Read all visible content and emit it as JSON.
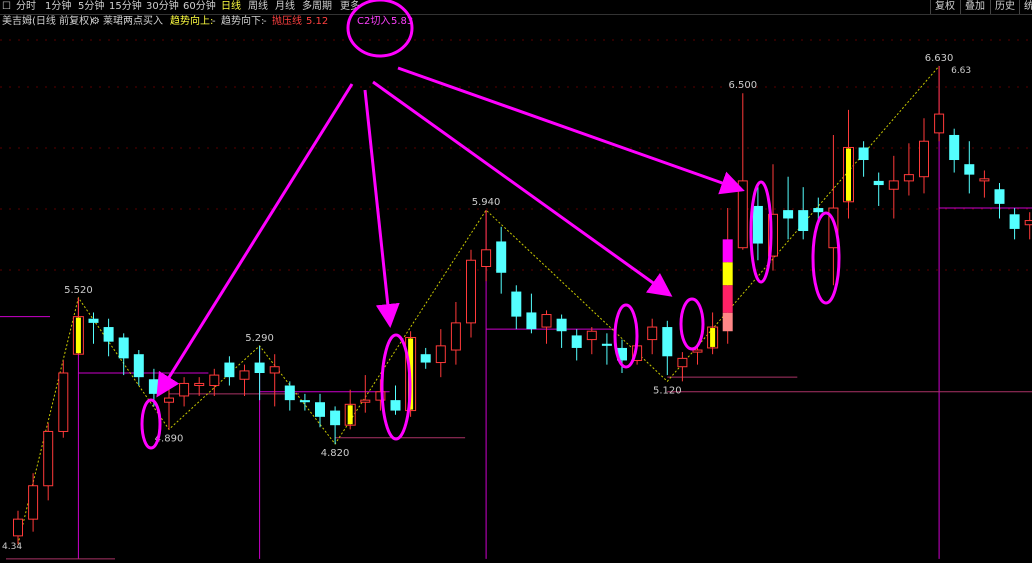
{
  "toolbar": {
    "icon_label": "☐",
    "periods": [
      {
        "label": "分时",
        "active": false
      },
      {
        "label": "1分钟",
        "active": false
      },
      {
        "label": "5分钟",
        "active": false
      },
      {
        "label": "15分钟",
        "active": false
      },
      {
        "label": "30分钟",
        "active": false
      },
      {
        "label": "60分钟",
        "active": false
      },
      {
        "label": "日线",
        "active": true
      },
      {
        "label": "周线",
        "active": false
      },
      {
        "label": "月线",
        "active": false
      },
      {
        "label": "多周期",
        "active": false
      },
      {
        "label": "更多",
        "active": false
      }
    ],
    "right_buttons": [
      "复权",
      "叠加",
      "历史",
      "统"
    ]
  },
  "legend": {
    "stock": "美吉姆(日线 前复权)",
    "indicator": "莱珺两点买入",
    "trend_up": "趋势向上:",
    "trend_up_value": "-",
    "trend_down": "趋势向下:",
    "trend_down_value": "-",
    "pressure_label": "抛压线",
    "pressure_value": "5.12",
    "c2_label": "C2切入",
    "c2_value": "5.83"
  },
  "colors": {
    "up": "#ff3a3a",
    "down": "#54ffff",
    "highlight": "#ffff00",
    "magenta": "#ff00ff",
    "pink": "#ff3399",
    "salmon": "#ff8888",
    "label": "#cccccc",
    "dashed": "#c8c800"
  },
  "chart_data": {
    "type": "candlestick",
    "ylim": [
      4.25,
      6.75
    ],
    "candles": [
      {
        "o": 4.38,
        "c": 4.46,
        "h": 4.5,
        "l": 4.34
      },
      {
        "o": 4.46,
        "c": 4.62,
        "h": 4.68,
        "l": 4.4
      },
      {
        "o": 4.62,
        "c": 4.88,
        "h": 4.92,
        "l": 4.55
      },
      {
        "o": 4.88,
        "c": 5.16,
        "h": 5.22,
        "l": 4.85
      },
      {
        "o": 5.25,
        "c": 5.43,
        "h": 5.52,
        "l": 5.25,
        "highlight": true
      },
      {
        "o": 5.42,
        "c": 5.4,
        "h": 5.45,
        "l": 5.3
      },
      {
        "o": 5.38,
        "c": 5.31,
        "h": 5.42,
        "l": 5.24
      },
      {
        "o": 5.33,
        "c": 5.23,
        "h": 5.35,
        "l": 5.15
      },
      {
        "o": 5.25,
        "c": 5.14,
        "h": 5.27,
        "l": 5.1
      },
      {
        "o": 5.13,
        "c": 5.06,
        "h": 5.18,
        "l": 5.0
      },
      {
        "o": 5.02,
        "c": 5.04,
        "h": 5.1,
        "l": 4.89
      },
      {
        "o": 5.05,
        "c": 5.11,
        "h": 5.14,
        "l": 5.0
      },
      {
        "o": 5.1,
        "c": 5.11,
        "h": 5.14,
        "l": 5.05
      },
      {
        "o": 5.1,
        "c": 5.15,
        "h": 5.18,
        "l": 5.05
      },
      {
        "o": 5.21,
        "c": 5.14,
        "h": 5.24,
        "l": 5.1
      },
      {
        "o": 5.13,
        "c": 5.17,
        "h": 5.2,
        "l": 5.05
      },
      {
        "o": 5.21,
        "c": 5.16,
        "h": 5.29,
        "l": 5.03
      },
      {
        "o": 5.16,
        "c": 5.19,
        "h": 5.25,
        "l": 5.0
      },
      {
        "o": 5.1,
        "c": 5.03,
        "h": 5.12,
        "l": 4.98
      },
      {
        "o": 5.03,
        "c": 5.02,
        "h": 5.06,
        "l": 4.98
      },
      {
        "o": 5.02,
        "c": 4.95,
        "h": 5.06,
        "l": 4.9
      },
      {
        "o": 4.98,
        "c": 4.91,
        "h": 5.0,
        "l": 4.82
      },
      {
        "o": 4.91,
        "c": 5.01,
        "h": 5.08,
        "l": 4.89,
        "highlight": true
      },
      {
        "o": 5.02,
        "c": 5.03,
        "h": 5.15,
        "l": 4.97
      },
      {
        "o": 5.03,
        "c": 5.07,
        "h": 5.13,
        "l": 4.98
      },
      {
        "o": 5.03,
        "c": 4.98,
        "h": 5.1,
        "l": 4.96
      },
      {
        "o": 4.98,
        "c": 5.33,
        "h": 5.36,
        "l": 4.95,
        "highlight": true
      },
      {
        "o": 5.25,
        "c": 5.21,
        "h": 5.28,
        "l": 5.18
      },
      {
        "o": 5.21,
        "c": 5.29,
        "h": 5.37,
        "l": 5.14
      },
      {
        "o": 5.27,
        "c": 5.4,
        "h": 5.5,
        "l": 5.2
      },
      {
        "o": 5.4,
        "c": 5.7,
        "h": 5.75,
        "l": 5.33
      },
      {
        "o": 5.67,
        "c": 5.75,
        "h": 5.94,
        "l": 5.6
      },
      {
        "o": 5.79,
        "c": 5.64,
        "h": 5.86,
        "l": 5.54
      },
      {
        "o": 5.55,
        "c": 5.43,
        "h": 5.58,
        "l": 5.37
      },
      {
        "o": 5.45,
        "c": 5.37,
        "h": 5.54,
        "l": 5.35
      },
      {
        "o": 5.38,
        "c": 5.44,
        "h": 5.46,
        "l": 5.3
      },
      {
        "o": 5.42,
        "c": 5.36,
        "h": 5.44,
        "l": 5.28
      },
      {
        "o": 5.34,
        "c": 5.28,
        "h": 5.37,
        "l": 5.22
      },
      {
        "o": 5.32,
        "c": 5.36,
        "h": 5.38,
        "l": 5.25
      },
      {
        "o": 5.3,
        "c": 5.29,
        "h": 5.35,
        "l": 5.2
      },
      {
        "o": 5.28,
        "c": 5.22,
        "h": 5.32,
        "l": 5.16
      },
      {
        "o": 5.22,
        "c": 5.29,
        "h": 5.36,
        "l": 5.2
      },
      {
        "o": 5.32,
        "c": 5.38,
        "h": 5.42,
        "l": 5.25
      },
      {
        "o": 5.38,
        "c": 5.24,
        "h": 5.41,
        "l": 5.15
      },
      {
        "o": 5.19,
        "c": 5.23,
        "h": 5.26,
        "l": 5.12
      },
      {
        "o": 5.26,
        "c": 5.27,
        "h": 5.3,
        "l": 5.2
      },
      {
        "o": 5.28,
        "c": 5.38,
        "h": 5.45,
        "l": 5.25,
        "highlight": true
      },
      {
        "o": 5.36,
        "c": 5.8,
        "h": 5.95,
        "l": 5.3,
        "tower": true
      },
      {
        "o": 5.76,
        "c": 6.08,
        "h": 6.5,
        "l": 5.75
      },
      {
        "o": 5.96,
        "c": 5.78,
        "h": 6.06,
        "l": 5.7
      },
      {
        "o": 5.72,
        "c": 5.92,
        "h": 6.16,
        "l": 5.65
      },
      {
        "o": 5.94,
        "c": 5.9,
        "h": 6.1,
        "l": 5.8
      },
      {
        "o": 5.94,
        "c": 5.84,
        "h": 6.05,
        "l": 5.8
      },
      {
        "o": 5.95,
        "c": 5.93,
        "h": 6.0,
        "l": 5.88
      },
      {
        "o": 5.76,
        "c": 5.95,
        "h": 6.3,
        "l": 5.58
      },
      {
        "o": 5.98,
        "c": 6.24,
        "h": 6.42,
        "l": 5.9,
        "highlight": true
      },
      {
        "o": 6.24,
        "c": 6.18,
        "h": 6.27,
        "l": 6.1
      },
      {
        "o": 6.08,
        "c": 6.06,
        "h": 6.12,
        "l": 5.96
      },
      {
        "o": 6.04,
        "c": 6.08,
        "h": 6.2,
        "l": 5.9
      },
      {
        "o": 6.08,
        "c": 6.11,
        "h": 6.26,
        "l": 6.01
      },
      {
        "o": 6.1,
        "c": 6.27,
        "h": 6.38,
        "l": 6.02
      },
      {
        "o": 6.31,
        "c": 6.4,
        "h": 6.63,
        "l": 6.27
      },
      {
        "o": 6.3,
        "c": 6.18,
        "h": 6.33,
        "l": 6.12
      },
      {
        "o": 6.16,
        "c": 6.11,
        "h": 6.27,
        "l": 6.02
      },
      {
        "o": 6.08,
        "c": 6.09,
        "h": 6.13,
        "l": 6.0
      },
      {
        "o": 6.04,
        "c": 5.97,
        "h": 6.07,
        "l": 5.9
      },
      {
        "o": 5.92,
        "c": 5.85,
        "h": 5.95,
        "l": 5.8
      },
      {
        "o": 5.87,
        "c": 5.89,
        "h": 5.93,
        "l": 5.8
      }
    ],
    "peaks": [
      {
        "idx": 4,
        "price": 5.52,
        "label": "5.520",
        "level": 5.16,
        "pos": "above"
      },
      {
        "idx": 10,
        "price": 4.89,
        "label": "4.890",
        "level": 5.06,
        "pos": "below"
      },
      {
        "idx": 16,
        "price": 5.29,
        "label": "5.290",
        "level": 5.07,
        "pos": "above"
      },
      {
        "idx": 21,
        "price": 4.82,
        "label": "4.820",
        "level": 4.85,
        "pos": "below"
      },
      {
        "idx": 31,
        "price": 5.94,
        "label": "5.940",
        "level": 5.37,
        "pos": "above"
      },
      {
        "idx": 43,
        "price": 5.12,
        "label": "5.120",
        "level": 5.14,
        "pos": "below"
      },
      {
        "idx": 48,
        "price": 6.5,
        "label": "6.500",
        "level": null,
        "pos": "above"
      },
      {
        "idx": 61,
        "price": 6.63,
        "label": "6.630",
        "level": 5.95,
        "pos": "above"
      }
    ],
    "price_labels": [
      {
        "text": "6.63",
        "price": 6.63
      },
      {
        "text": "4.34",
        "price": 4.34
      }
    ],
    "zigzag_idx": [
      0,
      4,
      10,
      16,
      21,
      31,
      43,
      61
    ]
  }
}
